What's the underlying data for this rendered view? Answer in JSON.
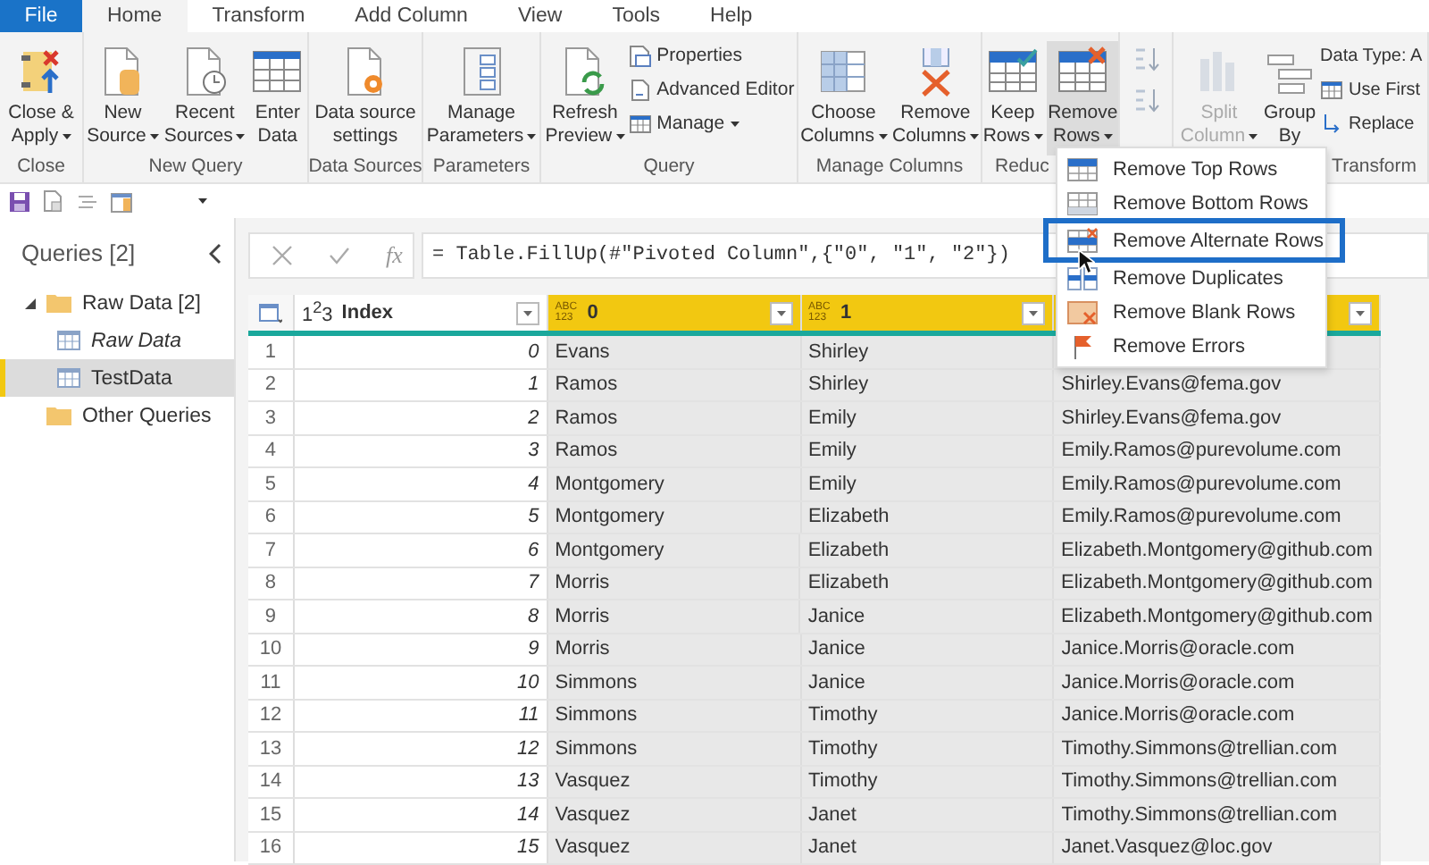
{
  "app_menu": [
    {
      "label": "File",
      "kind": "file",
      "selected": false
    },
    {
      "label": "Home",
      "kind": "tab",
      "selected": true
    },
    {
      "label": "Transform",
      "kind": "tab",
      "selected": false
    },
    {
      "label": "Add Column",
      "kind": "tab",
      "selected": false
    },
    {
      "label": "View",
      "kind": "tab",
      "selected": false
    },
    {
      "label": "Tools",
      "kind": "tab",
      "selected": false
    },
    {
      "label": "Help",
      "kind": "tab",
      "selected": false
    }
  ],
  "ribbon": {
    "groups": [
      {
        "label": "Close",
        "items": [
          {
            "kind": "large",
            "lines": [
              "Close &",
              "Apply"
            ],
            "dropdown": true,
            "pressed": false,
            "disabled": false
          }
        ]
      },
      {
        "label": "New Query",
        "items": [
          {
            "kind": "large",
            "lines": [
              "New",
              "Source"
            ],
            "dropdown": true,
            "pressed": false,
            "disabled": false
          },
          {
            "kind": "large",
            "lines": [
              "Recent",
              "Sources"
            ],
            "dropdown": true,
            "pressed": false,
            "disabled": false
          },
          {
            "kind": "large",
            "lines": [
              "Enter",
              "Data"
            ],
            "dropdown": false,
            "pressed": false,
            "disabled": false
          }
        ]
      },
      {
        "label": "Data Sources",
        "items": [
          {
            "kind": "large",
            "lines": [
              "Data source",
              "settings"
            ],
            "dropdown": false,
            "pressed": false,
            "disabled": false
          }
        ]
      },
      {
        "label": "Parameters",
        "items": [
          {
            "kind": "large",
            "lines": [
              "Manage",
              "Parameters"
            ],
            "dropdown": true,
            "pressed": false,
            "disabled": false
          }
        ]
      },
      {
        "label": "Query",
        "items": [
          {
            "kind": "large",
            "lines": [
              "Refresh",
              "Preview"
            ],
            "dropdown": true,
            "pressed": false,
            "disabled": false
          },
          {
            "kind": "stack",
            "items": [
              {
                "label": "Properties",
                "dropdown": false
              },
              {
                "label": "Advanced Editor",
                "dropdown": false
              },
              {
                "label": "Manage",
                "dropdown": true
              }
            ]
          }
        ]
      },
      {
        "label": "Manage Columns",
        "items": [
          {
            "kind": "large",
            "lines": [
              "Choose",
              "Columns"
            ],
            "dropdown": true,
            "pressed": false,
            "disabled": false
          },
          {
            "kind": "large",
            "lines": [
              "Remove",
              "Columns"
            ],
            "dropdown": true,
            "pressed": false,
            "disabled": false
          }
        ]
      },
      {
        "label": "Reduc",
        "items": [
          {
            "kind": "large",
            "lines": [
              "Keep",
              "Rows"
            ],
            "dropdown": true,
            "pressed": false,
            "disabled": false
          },
          {
            "kind": "large",
            "lines": [
              "Remove",
              "Rows"
            ],
            "dropdown": true,
            "pressed": true,
            "disabled": false
          }
        ]
      },
      {
        "items": [
          {
            "kind": "stack",
            "items": [
              {
                "kind": "icon"
              },
              {
                "kind": "icon"
              }
            ]
          }
        ]
      },
      {
        "label": "Transform",
        "items": [
          {
            "kind": "large",
            "lines": [
              "Split",
              "Column"
            ],
            "dropdown": true,
            "pressed": false,
            "disabled": true
          },
          {
            "kind": "large",
            "lines": [
              "Group",
              "By"
            ],
            "dropdown": false,
            "pressed": false,
            "disabled": false
          },
          {
            "kind": "stack",
            "items": [
              {
                "label": "Data Type: A",
                "dropdown": false
              },
              {
                "label": "Use First",
                "dropdown": false
              },
              {
                "label": "Replace",
                "dropdown": false
              }
            ]
          }
        ]
      }
    ]
  },
  "queries_panel": {
    "title": "Queries [2]",
    "tree": [
      {
        "label": "Raw Data [2]",
        "kind": "folder",
        "expanded": true,
        "selected": false,
        "children": [
          {
            "label": "Raw Data",
            "kind": "query",
            "load_enabled": false,
            "selected": false
          },
          {
            "label": "TestData",
            "kind": "query",
            "load_enabled": true,
            "selected": true
          }
        ]
      },
      {
        "label": "Other Queries",
        "kind": "folder",
        "expanded": false,
        "selected": false
      }
    ]
  },
  "formula_bar": {
    "fx": "fx",
    "formula": "= Table.FillUp(#\"Pivoted Column\",{\"0\", \"1\", \"2\"})"
  },
  "table": {
    "columns": [
      {
        "label": "Index",
        "type_label": "1$^{2}$3",
        "selected": false
      },
      {
        "label": "0",
        "type_label": "ABC 123",
        "selected": true
      },
      {
        "label": "1",
        "type_label": "ABC 123",
        "selected": true
      },
      {
        "selected": true
      }
    ],
    "rows": [
      {
        "num": "1",
        "index": "0",
        "col_0": "Evans",
        "col_1": "Shirley"
      },
      {
        "num": "2",
        "index": "1",
        "col_0": "Ramos",
        "col_1": "Shirley",
        "col_2": "Shirley.Evans@fema.gov"
      },
      {
        "num": "3",
        "index": "2",
        "col_0": "Ramos",
        "col_1": "Emily",
        "col_2": "Shirley.Evans@fema.gov"
      },
      {
        "num": "4",
        "index": "3",
        "col_0": "Ramos",
        "col_1": "Emily",
        "col_2": "Emily.Ramos@purevolume.com"
      },
      {
        "num": "5",
        "index": "4",
        "col_0": "Montgomery",
        "col_1": "Emily",
        "col_2": "Emily.Ramos@purevolume.com"
      },
      {
        "num": "6",
        "index": "5",
        "col_0": "Montgomery",
        "col_1": "Elizabeth",
        "col_2": "Emily.Ramos@purevolume.com"
      },
      {
        "num": "7",
        "index": "6",
        "col_0": "Montgomery",
        "col_1": "Elizabeth",
        "col_2": "Elizabeth.Montgomery@github.com"
      },
      {
        "num": "8",
        "index": "7",
        "col_0": "Morris",
        "col_1": "Elizabeth",
        "col_2": "Elizabeth.Montgomery@github.com"
      },
      {
        "num": "9",
        "index": "8",
        "col_0": "Morris",
        "col_1": "Janice",
        "col_2": "Elizabeth.Montgomery@github.com"
      },
      {
        "num": "10",
        "index": "9",
        "col_0": "Morris",
        "col_1": "Janice",
        "col_2": "Janice.Morris@oracle.com"
      },
      {
        "num": "11",
        "index": "10",
        "col_0": "Simmons",
        "col_1": "Janice",
        "col_2": "Janice.Morris@oracle.com"
      },
      {
        "num": "12",
        "index": "11",
        "col_0": "Simmons",
        "col_1": "Timothy",
        "col_2": "Janice.Morris@oracle.com"
      },
      {
        "num": "13",
        "index": "12",
        "col_0": "Simmons",
        "col_1": "Timothy",
        "col_2": "Timothy.Simmons@trellian.com"
      },
      {
        "num": "14",
        "index": "13",
        "col_0": "Vasquez",
        "col_1": "Timothy",
        "col_2": "Timothy.Simmons@trellian.com"
      },
      {
        "num": "15",
        "index": "14",
        "col_0": "Vasquez",
        "col_1": "Janet",
        "col_2": "Timothy.Simmons@trellian.com"
      },
      {
        "num": "16",
        "index": "15",
        "col_0": "Vasquez",
        "col_1": "Janet",
        "col_2": "Janet.Vasquez@loc.gov"
      }
    ]
  },
  "remove_rows_menu": {
    "items": [
      {
        "label": "Remove Top Rows",
        "selected": false
      },
      {
        "label": "Remove Bottom Rows",
        "selected": false
      },
      {
        "label": "Remove Alternate Rows",
        "selected": true
      },
      {
        "label": "Remove Duplicates",
        "selected": false
      },
      {
        "label": "Remove Blank Rows",
        "selected": false
      },
      {
        "label": "Remove Errors",
        "selected": false
      }
    ]
  }
}
